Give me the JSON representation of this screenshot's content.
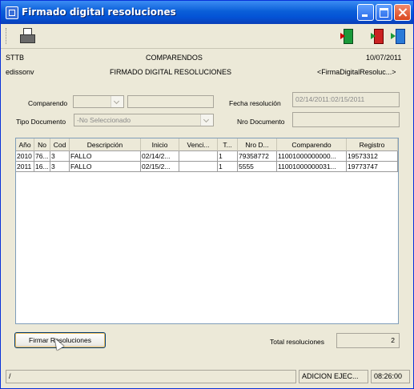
{
  "window": {
    "title": "Firmado digital resoluciones"
  },
  "toolbar": {
    "icons": [
      "printer-icon",
      "exit-door-icon",
      "door-icon",
      "enter-door-icon"
    ]
  },
  "header": {
    "left_top": "STTB",
    "center_top": "COMPARENDOS",
    "right_top": "10/07/2011",
    "left_bottom": "edissonv",
    "center_bottom": "FIRMADO DIGITAL RESOLUCIONES",
    "right_bottom": "<FirmaDigitalResoluc...>"
  },
  "form": {
    "comparendo_label": "Comparendo",
    "comparendo_select": "",
    "comparendo_value": "",
    "fecha_label": "Fecha resolución",
    "fecha_value": "02/14/2011:02/15/2011",
    "tipo_label": "Tipo Documento",
    "tipo_value": "-No Seleccionado",
    "nro_label": "Nro Documento",
    "nro_value": ""
  },
  "table": {
    "headers": [
      "Año",
      "No",
      "Cod",
      "Descripción",
      "Inicio",
      "Venci...",
      "T...",
      "Nro D...",
      "Comparendo",
      "Registro"
    ],
    "rows": [
      [
        "2010",
        "76...",
        "3",
        "FALLO",
        "02/14/2...",
        "",
        "1",
        "79358772",
        "11001000000000...",
        "19573312"
      ],
      [
        "2011",
        "16...",
        "3",
        "FALLO",
        "02/15/2...",
        "",
        "1",
        "5555",
        "11001000000031...",
        "19773747"
      ]
    ]
  },
  "footer": {
    "firmar_label": "Firmar Resoluciones",
    "total_label": "Total resoluciones",
    "total_value": "2"
  },
  "statusbar": {
    "left": "/",
    "mode": "ADICION EJEC...",
    "time": "08:26:00"
  },
  "colors": {
    "title_blue": "#0453d6",
    "close_red": "#d9461e",
    "window_bg": "#ece9d8"
  }
}
